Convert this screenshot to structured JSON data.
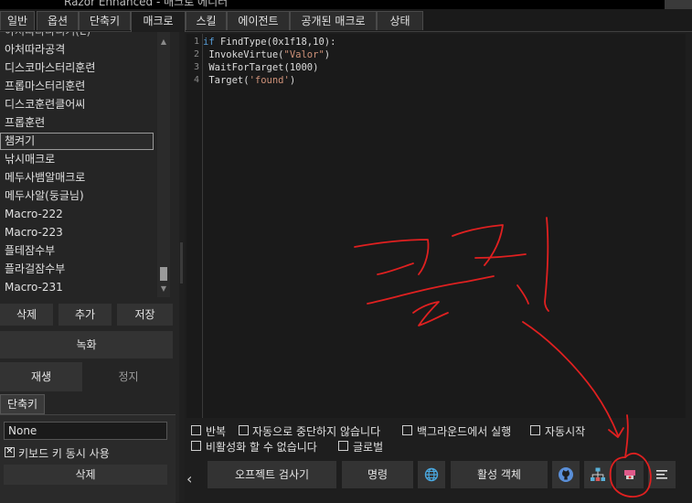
{
  "window": {
    "title": "Razor Enhanced - 매크로 에디터"
  },
  "tabs": [
    {
      "label": "일반"
    },
    {
      "label": "옵션"
    },
    {
      "label": "단축키"
    },
    {
      "label": "매크로"
    },
    {
      "label": "스킬"
    },
    {
      "label": "에이전트"
    },
    {
      "label": "공개된 매크로"
    },
    {
      "label": "상태"
    }
  ],
  "macros": {
    "items": [
      "아처따라공격",
      "디스코마스터리훈련",
      "프롭마스터리훈련",
      "디스코훈련클어씨",
      "프롭훈련",
      "챔켜기",
      "낚시매크로",
      "메두사뱀알매크로",
      "메두사알(둥글님)",
      "Macro-222",
      "Macro-223",
      "플테잠수부",
      "플라걸잠수부",
      "Macro-231"
    ],
    "selected": "챔켜기",
    "delete_label": "삭제",
    "add_label": "추가",
    "save_label": "저장",
    "record_label": "녹화",
    "play_label": "재생",
    "stop_label": "정지"
  },
  "hotkey": {
    "section_label": "단축키",
    "value": "None",
    "simultaneous_label": "키보드 키 동시 사용",
    "simultaneous_checked": true,
    "delete_label": "삭제"
  },
  "editor": {
    "line_numbers": [
      "1",
      "2",
      "3",
      "4"
    ],
    "lines": [
      {
        "parts": [
          {
            "t": "if",
            "c": "kw"
          },
          {
            "t": " FindType(0x1f18,10):",
            "c": ""
          }
        ]
      },
      {
        "parts": [
          {
            "t": " InvokeVirtue(",
            "c": ""
          },
          {
            "t": "\"Valor\"",
            "c": "str"
          },
          {
            "t": ")",
            "c": ""
          }
        ]
      },
      {
        "parts": [
          {
            "t": " WaitForTarget(1000)",
            "c": ""
          }
        ]
      },
      {
        "parts": [
          {
            "t": " Target(",
            "c": ""
          },
          {
            "t": "'found'",
            "c": "str"
          },
          {
            "t": ")",
            "c": ""
          }
        ]
      }
    ]
  },
  "options": {
    "repeat": "반복",
    "no_auto_stop": "자동으로 중단하지 않습니다",
    "background_run": "백그라운드에서 실행",
    "auto_start": "자동시작",
    "cannot_disable": "비활성화 할 수 없습니다",
    "global": "글로벌"
  },
  "toolbar": {
    "object_inspector": "오프젝트 검사기",
    "command": "명령",
    "active_object": "활성 객체"
  },
  "icons": {
    "globe": "globe-icon",
    "github": "github-icon",
    "hierarchy": "hierarchy-icon",
    "record": "record-icon",
    "menu": "menu-icon"
  },
  "annotation": {
    "text": "클릭",
    "color": "#e02020"
  }
}
